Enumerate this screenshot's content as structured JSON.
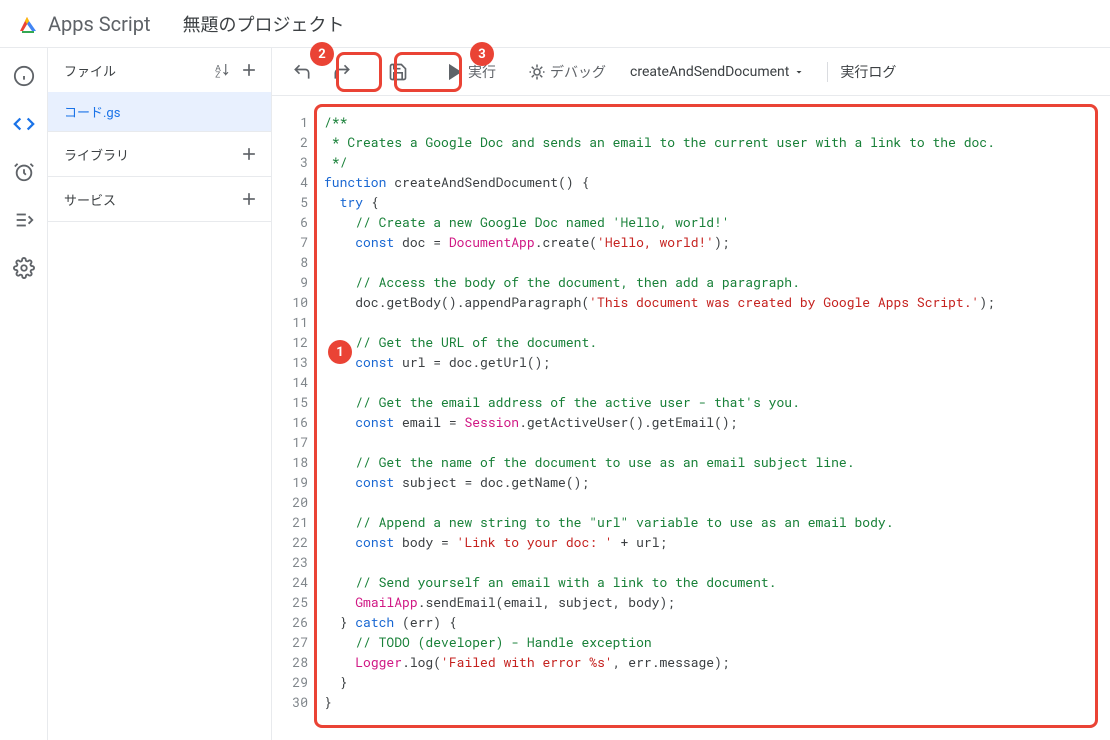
{
  "header": {
    "app_name": "Apps Script",
    "project_title": "無題のプロジェクト"
  },
  "sidebar": {
    "files_label": "ファイル",
    "file_name": "コード.gs",
    "libraries_label": "ライブラリ",
    "services_label": "サービス"
  },
  "toolbar": {
    "run_label": "実行",
    "debug_label": "デバッグ",
    "function_name": "createAndSendDocument",
    "log_label": "実行ログ"
  },
  "callouts": {
    "c1": "1",
    "c2": "2",
    "c3": "3"
  },
  "code": {
    "lines": [
      {
        "n": 1,
        "segs": [
          [
            "comment",
            "/**"
          ]
        ]
      },
      {
        "n": 2,
        "segs": [
          [
            "comment",
            " * Creates a Google Doc and sends an email to the current user with a link to the doc."
          ]
        ]
      },
      {
        "n": 3,
        "segs": [
          [
            "comment",
            " */"
          ]
        ]
      },
      {
        "n": 4,
        "segs": [
          [
            "keyword",
            "function"
          ],
          [
            "ident",
            " createAndSendDocument"
          ],
          [
            "ident",
            "() {"
          ]
        ]
      },
      {
        "n": 5,
        "segs": [
          [
            "ident",
            "  "
          ],
          [
            "keyword",
            "try"
          ],
          [
            "ident",
            " {"
          ]
        ]
      },
      {
        "n": 6,
        "segs": [
          [
            "ident",
            "    "
          ],
          [
            "comment",
            "// Create a new Google Doc named 'Hello, world!'"
          ]
        ]
      },
      {
        "n": 7,
        "segs": [
          [
            "ident",
            "    "
          ],
          [
            "keyword",
            "const"
          ],
          [
            "ident",
            " doc = "
          ],
          [
            "pink",
            "DocumentApp"
          ],
          [
            "ident",
            ".create("
          ],
          [
            "string",
            "'Hello, world!'"
          ],
          [
            "ident",
            ");"
          ]
        ]
      },
      {
        "n": 8,
        "segs": [
          [
            "ident",
            ""
          ]
        ]
      },
      {
        "n": 9,
        "segs": [
          [
            "ident",
            "    "
          ],
          [
            "comment",
            "// Access the body of the document, then add a paragraph."
          ]
        ]
      },
      {
        "n": 10,
        "segs": [
          [
            "ident",
            "    doc.getBody().appendParagraph("
          ],
          [
            "string",
            "'This document was created by Google Apps Script.'"
          ],
          [
            "ident",
            ");"
          ]
        ]
      },
      {
        "n": 11,
        "segs": [
          [
            "ident",
            ""
          ]
        ]
      },
      {
        "n": 12,
        "segs": [
          [
            "ident",
            "    "
          ],
          [
            "comment",
            "// Get the URL of the document."
          ]
        ]
      },
      {
        "n": 13,
        "segs": [
          [
            "ident",
            "    "
          ],
          [
            "keyword",
            "const"
          ],
          [
            "ident",
            " url = doc.getUrl();"
          ]
        ]
      },
      {
        "n": 14,
        "segs": [
          [
            "ident",
            ""
          ]
        ]
      },
      {
        "n": 15,
        "segs": [
          [
            "ident",
            "    "
          ],
          [
            "comment",
            "// Get the email address of the active user - that's you."
          ]
        ]
      },
      {
        "n": 16,
        "segs": [
          [
            "ident",
            "    "
          ],
          [
            "keyword",
            "const"
          ],
          [
            "ident",
            " email = "
          ],
          [
            "pink",
            "Session"
          ],
          [
            "ident",
            ".getActiveUser().getEmail();"
          ]
        ]
      },
      {
        "n": 17,
        "segs": [
          [
            "ident",
            ""
          ]
        ]
      },
      {
        "n": 18,
        "segs": [
          [
            "ident",
            "    "
          ],
          [
            "comment",
            "// Get the name of the document to use as an email subject line."
          ]
        ]
      },
      {
        "n": 19,
        "segs": [
          [
            "ident",
            "    "
          ],
          [
            "keyword",
            "const"
          ],
          [
            "ident",
            " subject = doc.getName();"
          ]
        ]
      },
      {
        "n": 20,
        "segs": [
          [
            "ident",
            ""
          ]
        ]
      },
      {
        "n": 21,
        "segs": [
          [
            "ident",
            "    "
          ],
          [
            "comment",
            "// Append a new string to the \"url\" variable to use as an email body."
          ]
        ]
      },
      {
        "n": 22,
        "segs": [
          [
            "ident",
            "    "
          ],
          [
            "keyword",
            "const"
          ],
          [
            "ident",
            " body = "
          ],
          [
            "string",
            "'Link to your doc: '"
          ],
          [
            "ident",
            " + url;"
          ]
        ]
      },
      {
        "n": 23,
        "segs": [
          [
            "ident",
            ""
          ]
        ]
      },
      {
        "n": 24,
        "segs": [
          [
            "ident",
            "    "
          ],
          [
            "comment",
            "// Send yourself an email with a link to the document."
          ]
        ]
      },
      {
        "n": 25,
        "segs": [
          [
            "ident",
            "    "
          ],
          [
            "pink",
            "GmailApp"
          ],
          [
            "ident",
            ".sendEmail(email, subject, body);"
          ]
        ]
      },
      {
        "n": 26,
        "segs": [
          [
            "ident",
            "  } "
          ],
          [
            "keyword",
            "catch"
          ],
          [
            "ident",
            " (err) {"
          ]
        ]
      },
      {
        "n": 27,
        "segs": [
          [
            "ident",
            "    "
          ],
          [
            "comment",
            "// TODO (developer) - Handle exception"
          ]
        ]
      },
      {
        "n": 28,
        "segs": [
          [
            "ident",
            "    "
          ],
          [
            "pink",
            "Logger"
          ],
          [
            "ident",
            ".log("
          ],
          [
            "string",
            "'Failed with error %s'"
          ],
          [
            "ident",
            ", err.message);"
          ]
        ]
      },
      {
        "n": 29,
        "segs": [
          [
            "ident",
            "  }"
          ]
        ]
      },
      {
        "n": 30,
        "segs": [
          [
            "ident",
            "}"
          ]
        ]
      }
    ]
  }
}
